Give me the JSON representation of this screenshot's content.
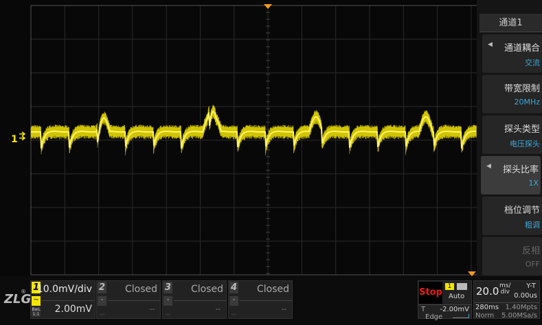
{
  "waveform": {
    "color": "#f5e600",
    "trigger_marker_color": "#f39a1b",
    "channel_label": "1"
  },
  "menu": {
    "title": "通道1",
    "items": [
      {
        "label": "通道耦合",
        "value": "交流",
        "arrow": true,
        "selected": false,
        "disabled": false
      },
      {
        "label": "带宽限制",
        "value": "20MHz",
        "arrow": false,
        "selected": false,
        "disabled": false
      },
      {
        "label": "探头类型",
        "value": "电压探头",
        "arrow": false,
        "selected": false,
        "disabled": false
      },
      {
        "label": "探头比率",
        "value": "1X",
        "arrow": true,
        "selected": true,
        "disabled": false
      },
      {
        "label": "档位调节",
        "value": "粗调",
        "arrow": false,
        "selected": false,
        "disabled": false
      },
      {
        "label": "反相",
        "value": "OFF",
        "arrow": false,
        "selected": false,
        "disabled": true
      }
    ]
  },
  "logo": "ZLG",
  "channels": [
    {
      "num": "1",
      "scale": "10.0mV/div",
      "offset": "2.00mV",
      "coupling": "~",
      "bwl": "BwL",
      "ratio": "1:1"
    },
    {
      "num": "2",
      "scale": "Closed",
      "offset": "--",
      "coupling": "-",
      "extra": "-:-"
    },
    {
      "num": "3",
      "scale": "Closed",
      "offset": "--",
      "coupling": "-",
      "extra": "-:-"
    },
    {
      "num": "4",
      "scale": "Closed",
      "offset": "--",
      "coupling": "-",
      "extra": "-:-"
    }
  ],
  "trigger": {
    "state": "Stop",
    "source": "1",
    "mode": "Auto",
    "level_label": "T",
    "level": "-2.00mV",
    "type": "Edge"
  },
  "timebase": {
    "value": "20.0",
    "unit_top": "ms/",
    "unit_bottom": "div",
    "mode": "Y-T",
    "delay": "0.00us",
    "record_time": "280ms",
    "points": "1.40Mpts",
    "acq": "Norm",
    "rate": "5.00MSa/s"
  }
}
